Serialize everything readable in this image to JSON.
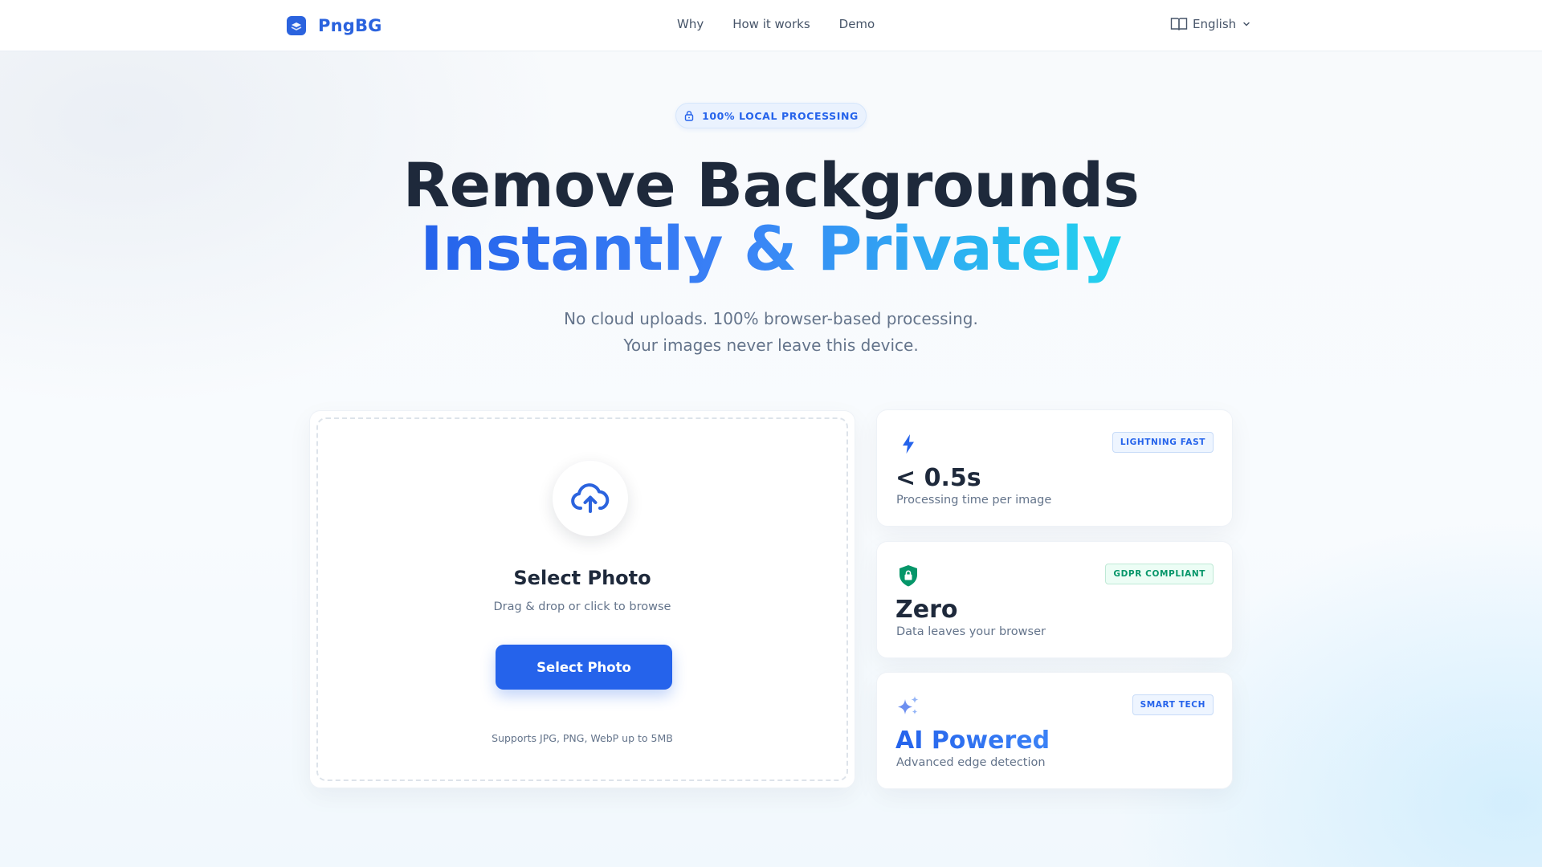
{
  "header": {
    "brand": "PngBG",
    "nav": [
      "Why",
      "How it works",
      "Demo"
    ],
    "language": "English"
  },
  "hero": {
    "badge": "100% LOCAL PROCESSING",
    "title_line1": "Remove Backgrounds",
    "title_line2": "Instantly & Privately",
    "subtitle_line1": "No cloud uploads. 100% browser-based processing.",
    "subtitle_line2": "Your images never leave this device."
  },
  "upload": {
    "title": "Select Photo",
    "subtitle": "Drag & drop or click to browse",
    "button_label": "Select Photo",
    "note": "Supports JPG, PNG, WebP up to 5MB"
  },
  "features": [
    {
      "icon": "lightning-icon",
      "badge": "LIGHTNING FAST",
      "value": "< 0.5s",
      "description": "Processing time per image"
    },
    {
      "icon": "shield-lock-icon",
      "badge": "GDPR COMPLIANT",
      "value": "Zero",
      "description": "Data leaves your browser"
    },
    {
      "icon": "sparkles-icon",
      "badge": "SMART TECH",
      "value": "AI Powered",
      "description": "Advanced edge detection"
    }
  ],
  "colors": {
    "accent": "#2563eb",
    "accent_light": "#22d3ee",
    "success": "#059669",
    "text_dark": "#1e293b",
    "text_muted": "#64748b"
  }
}
